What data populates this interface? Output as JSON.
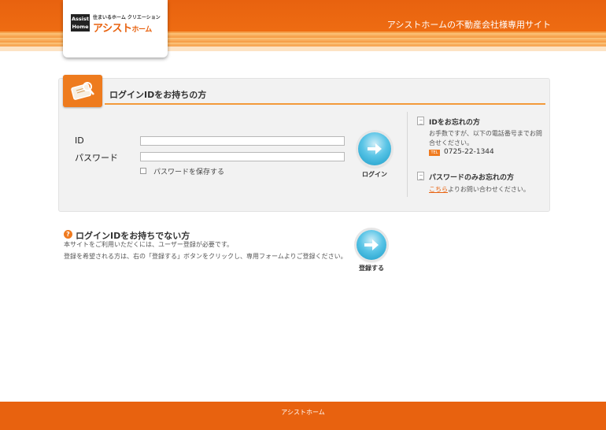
{
  "header": {
    "tagline": "アシストホームの不動産会社様専用サイト",
    "logo": {
      "mark": "Assist Home",
      "subtitle": "住まいるホーム クリエーション",
      "name": "アシスト",
      "name_small": "ホーム"
    }
  },
  "login": {
    "title": "ログインIDをお持ちの方",
    "id_label": "ID",
    "id_value": "",
    "password_label": "パスワード",
    "password_value": "",
    "remember_label": "パスワードを保存する",
    "login_button_label": "ログイン"
  },
  "forgot": {
    "id_title": "IDをお忘れの方",
    "id_text": "お手数ですが、以下の電話番号までお問合せください。",
    "tel_badge": "TEL",
    "tel_number": "0725-22-1344",
    "password_title": "パスワードのみお忘れの方",
    "password_link": "こちら",
    "password_text": "よりお問い合わせください。"
  },
  "register": {
    "icon": "?",
    "title": "ログインIDをお持ちでない方",
    "text1": "本サイトをご利用いただくには、ユーザー登録が必要です。",
    "text2": "登録を希望される方は、右の「登録する」ボタンをクリックし、専用フォームよりご登録ください。",
    "button_label": "登録する"
  },
  "footer": {
    "text": "アシストホーム"
  },
  "colors": {
    "brand_orange": "#e8620f",
    "button_blue": "#1a9cc8"
  }
}
